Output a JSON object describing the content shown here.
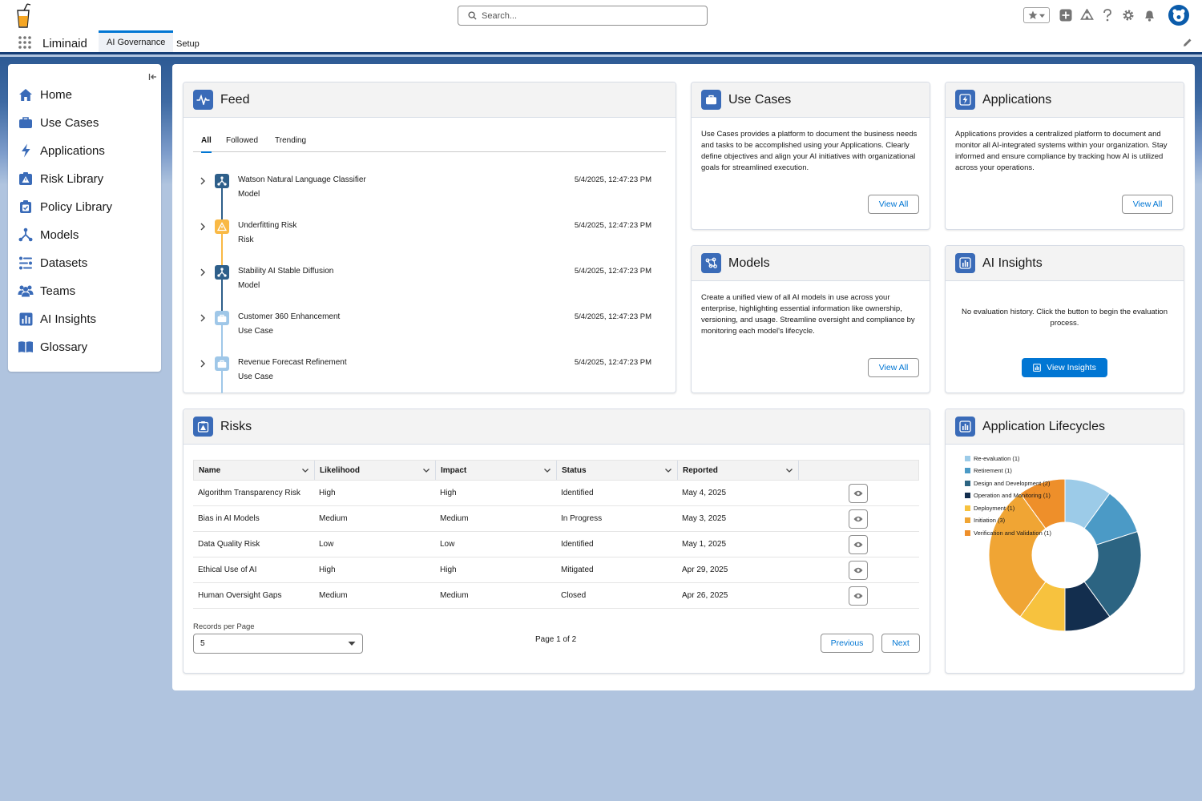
{
  "header": {
    "search_placeholder": "Search...",
    "icons": [
      "favorites-star-icon",
      "add-icon",
      "trailhead-icon",
      "help-icon",
      "setup-gear-icon",
      "notifications-bell-icon",
      "avatar"
    ]
  },
  "nav": {
    "app_name": "Liminaid",
    "tabs": [
      {
        "label": "AI Governance",
        "active": true
      },
      {
        "label": "Setup",
        "active": false
      }
    ]
  },
  "sidebar": {
    "items": [
      {
        "label": "Home",
        "icon": "home-icon"
      },
      {
        "label": "Use Cases",
        "icon": "briefcase-icon"
      },
      {
        "label": "Applications",
        "icon": "lightning-icon"
      },
      {
        "label": "Risk Library",
        "icon": "warning-icon"
      },
      {
        "label": "Policy Library",
        "icon": "clipboard-icon"
      },
      {
        "label": "Models",
        "icon": "network-icon"
      },
      {
        "label": "Datasets",
        "icon": "dataset-icon"
      },
      {
        "label": "Teams",
        "icon": "people-icon"
      },
      {
        "label": "AI Insights",
        "icon": "chart-icon"
      },
      {
        "label": "Glossary",
        "icon": "book-icon"
      }
    ]
  },
  "feed": {
    "title": "Feed",
    "tabs": [
      "All",
      "Followed",
      "Trending"
    ],
    "items": [
      {
        "title": "Watson Natural Language Classifier",
        "type": "Model",
        "date": "5/4/2025, 12:47:23 PM",
        "icon_color": "#2e5f8a"
      },
      {
        "title": "Underfitting Risk",
        "type": "Risk",
        "date": "5/4/2025, 12:47:23 PM",
        "icon_color": "#f9b945"
      },
      {
        "title": "Stability AI Stable Diffusion",
        "type": "Model",
        "date": "5/4/2025, 12:47:23 PM",
        "icon_color": "#2e5f8a"
      },
      {
        "title": "Customer 360 Enhancement",
        "type": "Use Case",
        "date": "5/4/2025, 12:47:23 PM",
        "icon_color": "#9fc7e8"
      },
      {
        "title": "Revenue Forecast Refinement",
        "type": "Use Case",
        "date": "5/4/2025, 12:47:23 PM",
        "icon_color": "#9fc7e8"
      }
    ]
  },
  "use_cases": {
    "title": "Use Cases",
    "description": "Use Cases provides a platform to document the business needs and tasks to be accomplished using your Applications. Clearly define objectives and align your AI initiatives with organizational goals for streamlined execution.",
    "button": "View All"
  },
  "applications": {
    "title": "Applications",
    "description": "Applications provides a centralized platform to document and monitor all AI-integrated systems within your organization. Stay informed and ensure compliance by tracking how AI is utilized across your operations.",
    "button": "View All"
  },
  "models": {
    "title": "Models",
    "description": "Create a unified view of all AI models in use across your enterprise, highlighting essential information like ownership, versioning, and usage. Streamline oversight and compliance by monitoring each model's lifecycle.",
    "button": "View All"
  },
  "ai_insights": {
    "title": "AI Insights",
    "description": "No evaluation history. Click the button to begin the evaluation process.",
    "button": "View Insights"
  },
  "risks": {
    "title": "Risks",
    "columns": [
      "Name",
      "Likelihood",
      "Impact",
      "Status",
      "Reported"
    ],
    "rows": [
      [
        "Algorithm Transparency Risk",
        "High",
        "High",
        "Identified",
        "May 4, 2025"
      ],
      [
        "Bias in AI Models",
        "Medium",
        "Medium",
        "In Progress",
        "May 3, 2025"
      ],
      [
        "Data Quality Risk",
        "Low",
        "Low",
        "Identified",
        "May 1, 2025"
      ],
      [
        "Ethical Use of AI",
        "High",
        "High",
        "Mitigated",
        "Apr 29, 2025"
      ],
      [
        "Human Oversight Gaps",
        "Medium",
        "Medium",
        "Closed",
        "Apr 26, 2025"
      ]
    ],
    "records_label": "Records per Page",
    "records_value": "5",
    "page_info": "Page 1 of 2",
    "prev": "Previous",
    "next": "Next"
  },
  "lifecycles": {
    "title": "Application Lifecycles",
    "legend": [
      {
        "label": "Re-evaluation (1)",
        "color": "#9ccbe8"
      },
      {
        "label": "Retirement (1)",
        "color": "#4b9ac6"
      },
      {
        "label": "Design and Development (2)",
        "color": "#2c6482"
      },
      {
        "label": "Operation and Monitoring (1)",
        "color": "#132e4e"
      },
      {
        "label": "Deployment (1)",
        "color": "#f7c23e"
      },
      {
        "label": "Initiation (3)",
        "color": "#f0a534"
      },
      {
        "label": "Verification and Validation (1)",
        "color": "#ee8f2a"
      }
    ]
  },
  "chart_data": {
    "type": "pie",
    "variant": "donut",
    "categories": [
      "Re-evaluation",
      "Retirement",
      "Design and Development",
      "Operation and Monitoring",
      "Deployment",
      "Initiation",
      "Verification and Validation"
    ],
    "values": [
      1,
      1,
      2,
      1,
      1,
      3,
      1
    ],
    "colors": [
      "#9ccbe8",
      "#4b9ac6",
      "#2c6482",
      "#132e4e",
      "#f7c23e",
      "#f0a534",
      "#ee8f2a"
    ],
    "legend": "top-left"
  }
}
